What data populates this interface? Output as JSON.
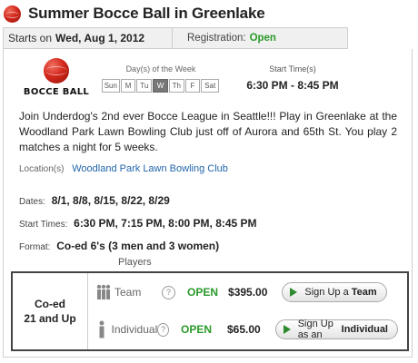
{
  "header": {
    "title": "Summer Bocce Ball in Greenlake",
    "icon": "bocce-ball-icon"
  },
  "summary_bar": {
    "starts_label": "Starts on",
    "starts_value": "Wed, Aug 1, 2012",
    "registration_label": "Registration:",
    "registration_value": "Open"
  },
  "logo": {
    "text": "BOCCE BALL",
    "icon": "bocce-ball-icon"
  },
  "days": {
    "label": "Day(s) of the Week",
    "items": [
      "Sun",
      "M",
      "Tu",
      "W",
      "Th",
      "F",
      "Sat"
    ],
    "selected": "W"
  },
  "start_time": {
    "label": "Start Time(s)",
    "value": "6:30 PM - 8:45 PM"
  },
  "description": "Join Underdog's 2nd ever Bocce League in Seattle!!! Play in Greenlake at the Woodland Park Lawn Bowling Club just off of Aurora and 65th St. You play 2 matches a night for 5 weeks.",
  "location": {
    "label": "Location(s)",
    "link": "Woodland Park Lawn Bowling Club"
  },
  "details": {
    "dates_label": "Dates:",
    "dates_value": "8/1, 8/8, 8/15, 8/22, 8/29",
    "start_times_label": "Start Times:",
    "start_times_value": "6:30 PM, 7:15 PM, 8:00 PM, 8:45 PM",
    "format_label": "Format:",
    "format_value": "Co-ed 6's (3 men and 3 women)"
  },
  "players": {
    "label": "Players",
    "division": {
      "line1": "Co-ed",
      "line2": "21 and Up"
    },
    "team": {
      "type": "Team",
      "help": "?",
      "status": "OPEN",
      "price": "$395.00",
      "button_prefix": "Sign Up a",
      "button_bold": "Team"
    },
    "individual": {
      "type": "Individual",
      "help": "?",
      "status": "OPEN",
      "price": "$65.00",
      "button_prefix": "Sign Up as an",
      "button_bold": "Individual"
    }
  },
  "colors": {
    "accent_green": "#2a9a2a",
    "ball_red": "#d2281c",
    "link_blue": "#2266aa"
  }
}
